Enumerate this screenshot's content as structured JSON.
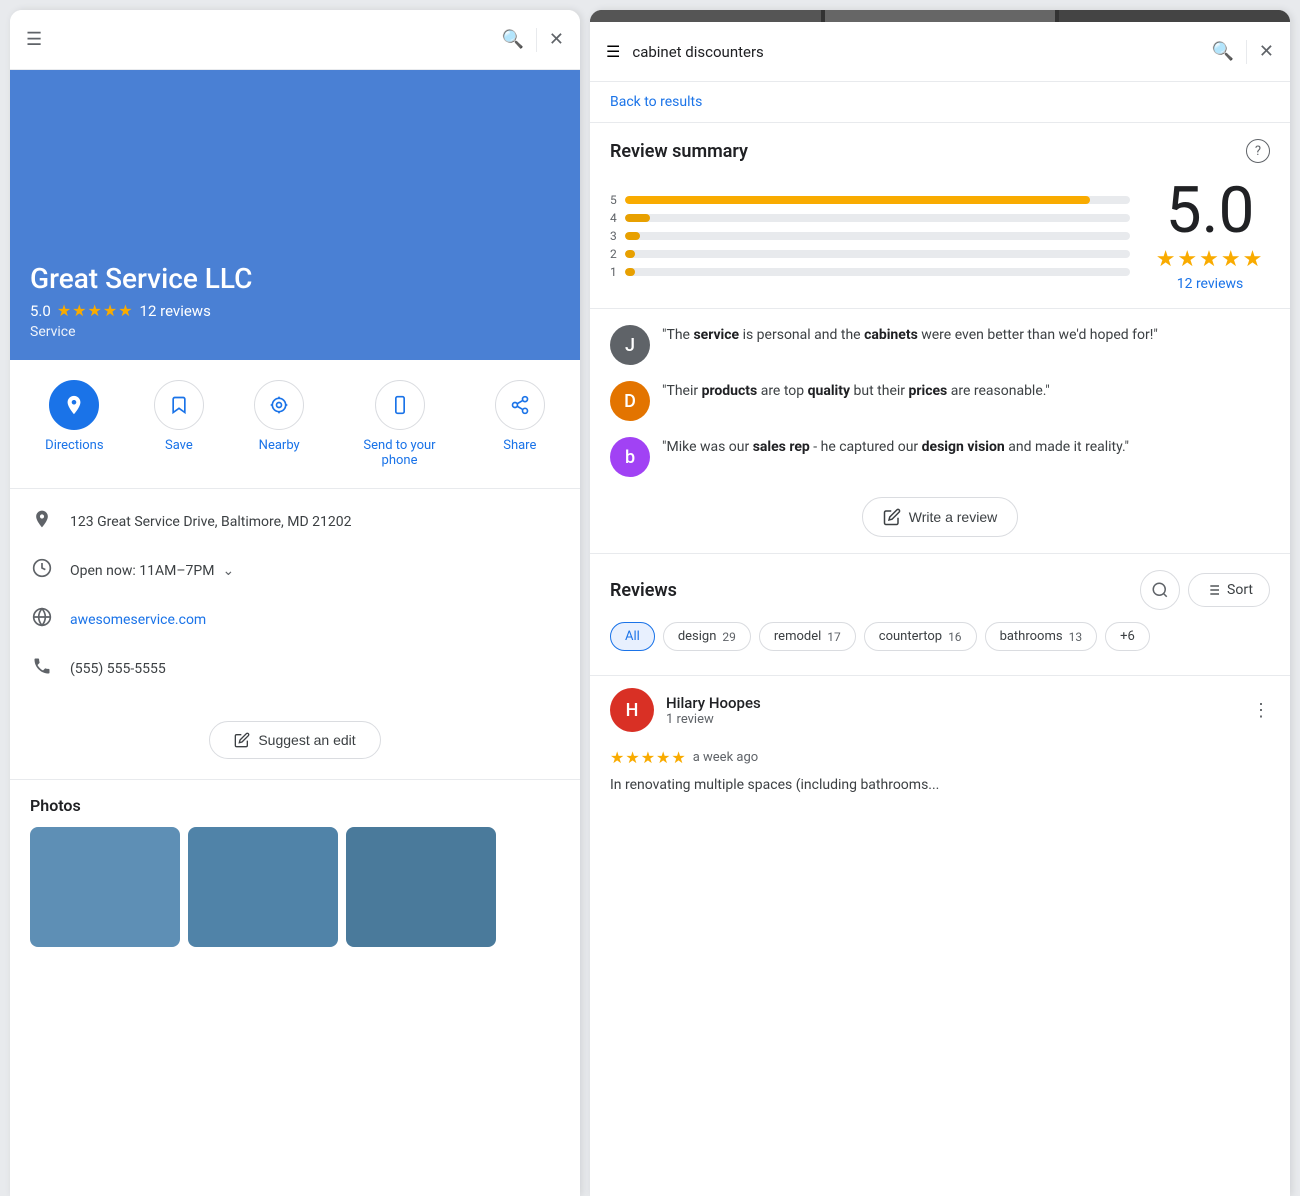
{
  "left": {
    "hero": {
      "business_name": "Great Service LLC",
      "rating": "5.0",
      "reviews_count": "12 reviews",
      "category": "Service"
    },
    "actions": [
      {
        "id": "directions",
        "label": "Directions",
        "icon": "◈",
        "primary": true
      },
      {
        "id": "save",
        "label": "Save",
        "icon": "🔖",
        "primary": false
      },
      {
        "id": "nearby",
        "label": "Nearby",
        "icon": "⊕",
        "primary": false
      },
      {
        "id": "send-to-phone",
        "label": "Send to your phone",
        "icon": "📱",
        "primary": false
      },
      {
        "id": "share",
        "label": "Share",
        "icon": "↗",
        "primary": false
      }
    ],
    "info": {
      "address": "123 Great Service Drive, Baltimore, MD 21202",
      "hours": "Open now:  11AM–7PM",
      "website": "awesomeservice.com",
      "phone": "(555) 555-5555"
    },
    "suggest_edit": "Suggest an edit",
    "photos_title": "Photos"
  },
  "right": {
    "search_text": "cabinet discounters",
    "back_label": "Back to results",
    "review_summary": {
      "title": "Review summary",
      "bars": [
        {
          "label": "5",
          "pct": 92
        },
        {
          "label": "4",
          "pct": 5
        },
        {
          "label": "3",
          "pct": 3
        },
        {
          "label": "2",
          "pct": 2
        },
        {
          "label": "1",
          "pct": 2
        }
      ],
      "score": "5.0",
      "stars": "★★★★★",
      "reviews_link": "12 reviews"
    },
    "snippets": [
      {
        "avatar_letter": "J",
        "avatar_color": "#5f6368",
        "text": "\"The service is personal and the cabinets were even better than we'd hoped for!\""
      },
      {
        "avatar_letter": "D",
        "avatar_color": "#e37400",
        "text": "\"Their products are top quality but their prices are reasonable.\""
      },
      {
        "avatar_letter": "b",
        "avatar_color": "#a142f4",
        "text": "\"Mike was our sales rep - he captured our design vision and made it reality.\""
      }
    ],
    "write_review": "Write a review",
    "reviews_title": "Reviews",
    "sort_label": "Sort",
    "filter_chips": [
      {
        "label": "All",
        "count": "",
        "active": true
      },
      {
        "label": "design",
        "count": "29",
        "active": false
      },
      {
        "label": "remodel",
        "count": "17",
        "active": false
      },
      {
        "label": "countertop",
        "count": "16",
        "active": false
      },
      {
        "label": "bathrooms",
        "count": "13",
        "active": false
      },
      {
        "label": "+6",
        "count": "",
        "active": false
      }
    ],
    "reviewer": {
      "avatar_letter": "H",
      "avatar_color": "#d93025",
      "name": "Hilary Hoopes",
      "sub": "1 review",
      "stars": "★★★★★",
      "time": "a week ago",
      "text": "In renovating multiple spaces (including bathrooms..."
    }
  }
}
